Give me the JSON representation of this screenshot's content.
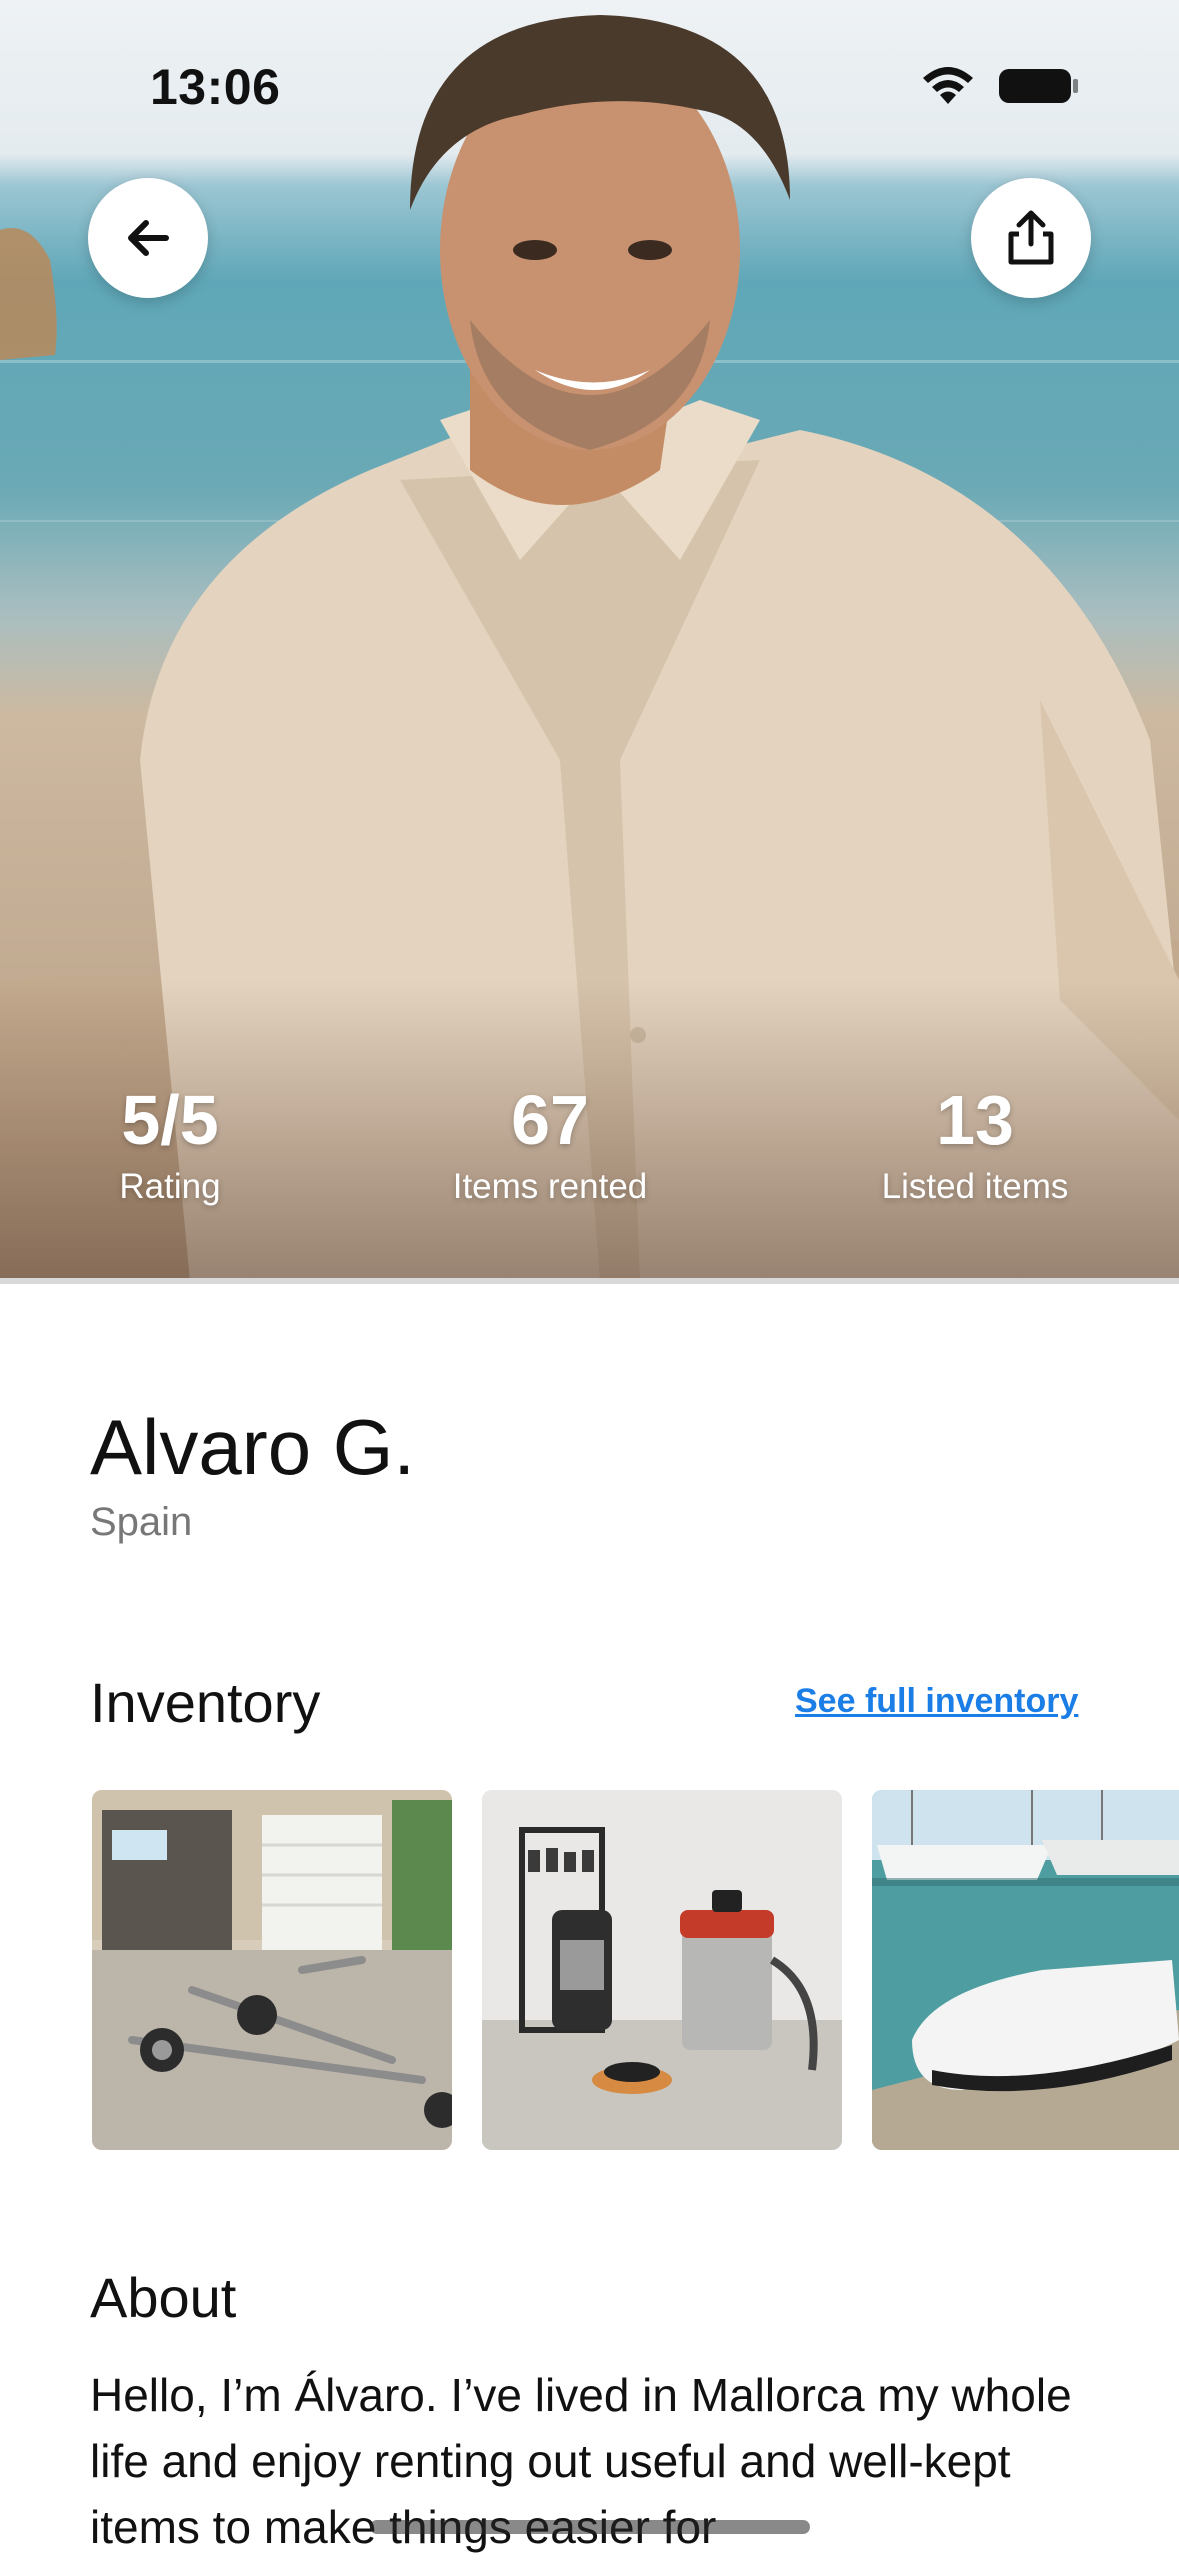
{
  "status_bar": {
    "time": "13:06"
  },
  "hero": {
    "image": "portrait-man-beach",
    "back_icon": "arrow-left-icon",
    "share_icon": "share-icon",
    "stats": [
      {
        "value": "5/5",
        "label": "Rating"
      },
      {
        "value": "67",
        "label": "Items rented"
      },
      {
        "value": "13",
        "label": "Listed items"
      }
    ]
  },
  "profile": {
    "name": "Alvaro G.",
    "country": "Spain"
  },
  "inventory": {
    "title": "Inventory",
    "link_label": "See full inventory",
    "items": [
      {
        "image": "boat-trailer-photo"
      },
      {
        "image": "pressure-washer-and-vacuum-photo"
      },
      {
        "image": "sea-scooter-at-marina-photo"
      }
    ]
  },
  "about": {
    "title": "About",
    "text": "Hello, I’m Álvaro. I’ve lived in Mallorca my whole life and enjoy renting out useful and well-kept items to make things easier for"
  },
  "colors": {
    "link": "#1a7ee6",
    "muted": "#777777"
  }
}
